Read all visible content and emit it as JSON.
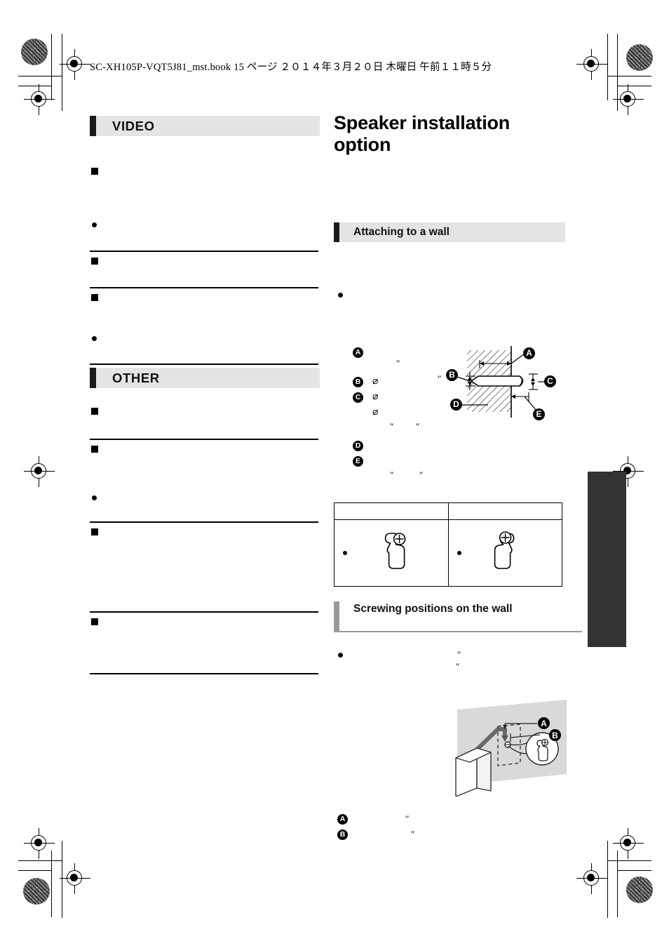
{
  "document": {
    "running_header": "SC-XH105P-VQT5J81_mst.book   15 ページ   ２０１４年３月２０日   木曜日   午前１１時５分",
    "page_number": "15"
  },
  "left_column": {
    "sections": [
      {
        "bar_label": "VIDEO",
        "marker_icons": [
          "square-marker",
          "bullet-marker",
          "square-marker",
          "square-marker"
        ]
      },
      {
        "bar_label": "OTHER",
        "marker_icons": [
          "square-marker",
          "square-marker",
          "bullet-marker",
          "square-marker",
          "square-marker"
        ]
      }
    ]
  },
  "right_column": {
    "page_title": "Speaker installation option",
    "section_heading": "Attaching to a wall",
    "subsection_heading": "Screwing positions on the wall",
    "wall_diagram": {
      "caption_letters": [
        "A",
        "B",
        "C",
        "D",
        "E"
      ],
      "callout_letters": [
        "A",
        "B",
        "C",
        "D",
        "E"
      ],
      "diameter_symbol": "⌀",
      "inch_symbol": "″",
      "legend_diameter_count": 3
    },
    "keyhole_table": {
      "columns": 2,
      "rows": 1,
      "column_headers": [
        "",
        ""
      ],
      "cell_bullets": [
        "•",
        "•"
      ],
      "cell_icons": [
        "keyhole-slot-left-icon",
        "keyhole-slot-right-icon"
      ]
    },
    "mount_diagram": {
      "callout_letters": [
        "A",
        "B"
      ],
      "inch_symbol": "″",
      "wall_fill": "#d9d9d9",
      "elements": [
        "wall-panel",
        "speaker-box",
        "dashed-outline",
        "arrow",
        "magnifier-inset"
      ]
    }
  },
  "print_marks": {
    "registration_icons": [
      "registration-crosshair",
      "registration-crosshair",
      "registration-crosshair",
      "registration-crosshair",
      "registration-crosshair",
      "registration-crosshair",
      "registration-crosshair",
      "registration-crosshair"
    ],
    "rosette_icons": [
      "rosette-target",
      "rosette-target",
      "rosette-target",
      "rosette-target"
    ],
    "thumb_tab_color": "#333333"
  },
  "colors": {
    "bar_background": "#e4e4e4",
    "bar_tick": "#1a1a1a",
    "grey_tick": "#999999",
    "rule": "#000000",
    "wall_grey": "#d9d9d9"
  }
}
